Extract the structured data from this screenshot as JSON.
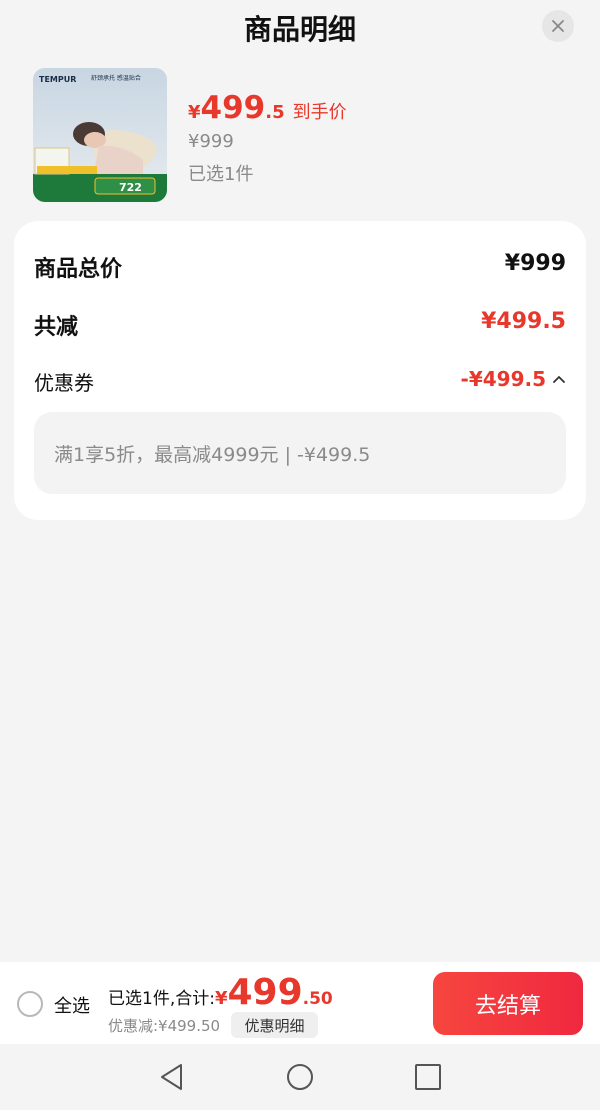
{
  "header": {
    "title": "商品明细",
    "close_icon": "close-icon"
  },
  "product": {
    "image_brand": "TEMPUR",
    "image_caption": "舒颈承托 感温贴合",
    "image_badge_price": "722",
    "price_currency": "¥",
    "price_integer": "499",
    "price_decimal": ".5",
    "price_tag": "到手价",
    "original_price": "¥999",
    "selected_count": "已选1件"
  },
  "summary": {
    "total_label": "商品总价",
    "total_value": "¥999",
    "reduce_label": "共减",
    "reduce_value": "¥499.5",
    "coupon_label": "优惠券",
    "coupon_value": "-¥499.5",
    "coupon_detail": "满1享5折，最高减4999元 | -¥499.5"
  },
  "bottom_bar": {
    "select_all_label": "全选",
    "total_prefix": "已选1件,合计:",
    "total_currency": "¥",
    "total_integer": "499",
    "total_decimal": ".50",
    "discount_text": "优惠减:¥499.50",
    "detail_button": "优惠明细",
    "checkout_button": "去结算"
  },
  "colors": {
    "accent_red": "#e8372b",
    "checkout_red": "#f03a3f",
    "background": "#f4f4f4"
  },
  "nav": {
    "back_icon": "back-triangle-icon",
    "home_icon": "home-circle-icon",
    "recent_icon": "recent-square-icon"
  }
}
